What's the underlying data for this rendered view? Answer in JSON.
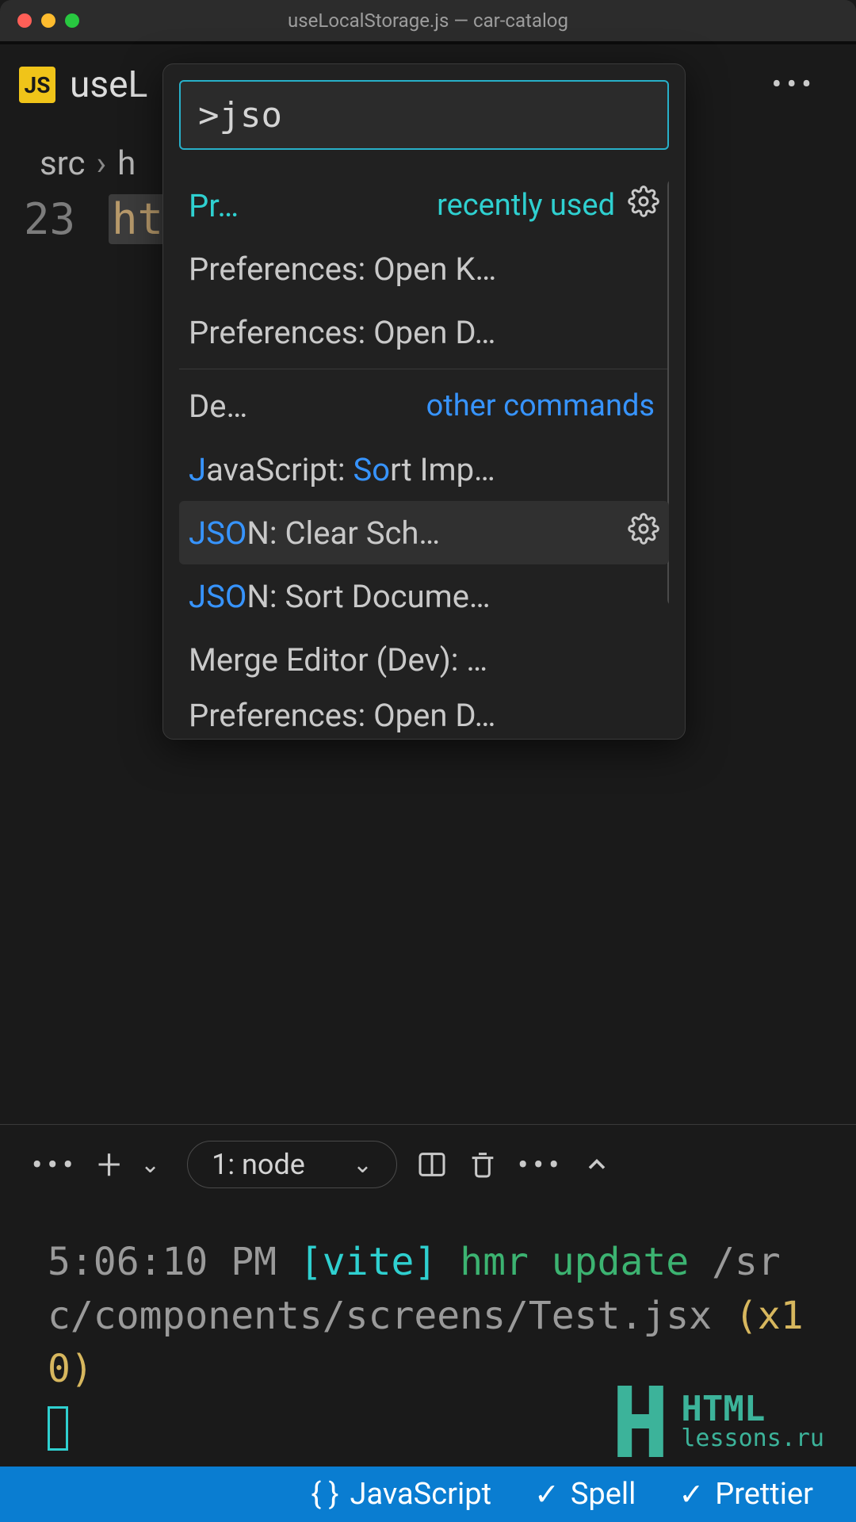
{
  "window": {
    "title": "useLocalStorage.js — car-catalog"
  },
  "tab": {
    "badge": "JS",
    "filename": "useL"
  },
  "breadcrumb": {
    "seg1": "src",
    "seg2": "h"
  },
  "editor": {
    "lineno": "23",
    "text": "ht"
  },
  "palette": {
    "input_value": ">jso",
    "recent_label": "recently used",
    "other_label": "other commands",
    "items": [
      {
        "pre": "Pr",
        "mid": "",
        "rest": "…",
        "section": "recent",
        "gear": true,
        "teal": true
      },
      {
        "pre": "",
        "mid": "",
        "rest": "Preferences: Open K…"
      },
      {
        "pre": "",
        "mid": "",
        "rest": "Preferences: Open D…"
      },
      {
        "pre": "De",
        "mid": "",
        "rest": "…",
        "section": "other"
      },
      {
        "pre": "",
        "hl1": "J",
        "mid": "avaScript: ",
        "hl2": "So",
        "rest": "rt Imp…"
      },
      {
        "pre": "",
        "hl1": "JSO",
        "mid": "",
        "rest": "N: Clear Sch…",
        "gear": true,
        "selected": true
      },
      {
        "pre": "",
        "hl1": "JSO",
        "mid": "",
        "rest": "N: Sort Docume…"
      },
      {
        "pre": "",
        "mid": "",
        "rest": "Merge Editor (Dev): …"
      },
      {
        "pre": "",
        "mid": "",
        "rest": "Preferences: Open D…",
        "cut": true
      }
    ]
  },
  "panel": {
    "select": "1: node"
  },
  "terminal": {
    "time": "5:06:10 PM",
    "tag": "[vite]",
    "msg": "hmr update",
    "path": "/src/components/screens/Test.jsx",
    "count": "(x10)"
  },
  "watermark": {
    "line1": "HTML",
    "line2": "lessons.ru"
  },
  "status": {
    "lang": "JavaScript",
    "spell": "Spell",
    "prettier": "Prettier"
  }
}
